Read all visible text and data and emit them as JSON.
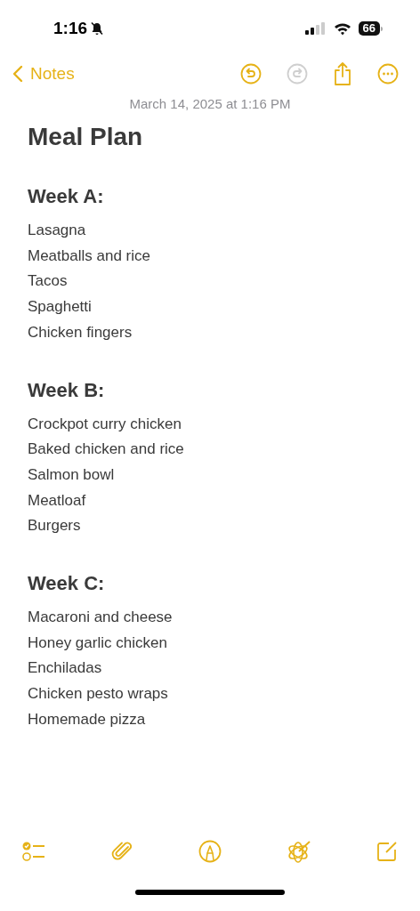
{
  "status_bar": {
    "time": "1:16",
    "silent": true,
    "battery": "66"
  },
  "nav": {
    "back_label": "Notes",
    "undo_disabled": false,
    "redo_disabled": true
  },
  "date": "March 14, 2025 at 1:16 PM",
  "title": "Meal Plan",
  "sections": [
    {
      "heading": "Week A:",
      "items": [
        "Lasagna",
        "Meatballs and rice",
        "Tacos",
        "Spaghetti",
        "Chicken fingers"
      ]
    },
    {
      "heading": "Week B:",
      "items": [
        "Crockpot curry chicken",
        "Baked chicken and rice",
        "Salmon bowl",
        "Meatloaf",
        "Burgers"
      ]
    },
    {
      "heading": "Week C:",
      "items": [
        "Macaroni and cheese",
        "Honey garlic chicken",
        "Enchiladas",
        "Chicken pesto wraps",
        "Homemade pizza"
      ]
    }
  ]
}
